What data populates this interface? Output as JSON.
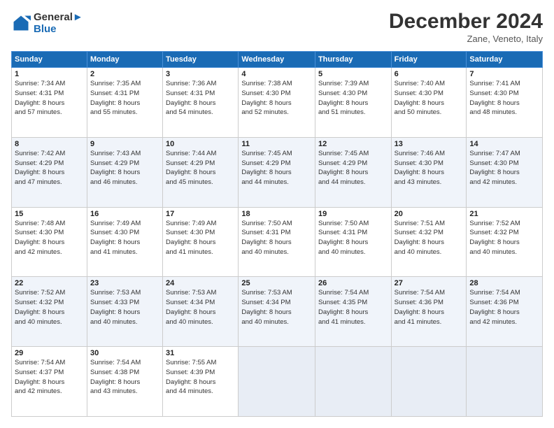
{
  "header": {
    "logo_line1": "General",
    "logo_line2": "Blue",
    "month_title": "December 2024",
    "location": "Zane, Veneto, Italy"
  },
  "days_of_week": [
    "Sunday",
    "Monday",
    "Tuesday",
    "Wednesday",
    "Thursday",
    "Friday",
    "Saturday"
  ],
  "weeks": [
    [
      {
        "day": "1",
        "lines": [
          "Sunrise: 7:34 AM",
          "Sunset: 4:31 PM",
          "Daylight: 8 hours",
          "and 57 minutes."
        ]
      },
      {
        "day": "2",
        "lines": [
          "Sunrise: 7:35 AM",
          "Sunset: 4:31 PM",
          "Daylight: 8 hours",
          "and 55 minutes."
        ]
      },
      {
        "day": "3",
        "lines": [
          "Sunrise: 7:36 AM",
          "Sunset: 4:31 PM",
          "Daylight: 8 hours",
          "and 54 minutes."
        ]
      },
      {
        "day": "4",
        "lines": [
          "Sunrise: 7:38 AM",
          "Sunset: 4:30 PM",
          "Daylight: 8 hours",
          "and 52 minutes."
        ]
      },
      {
        "day": "5",
        "lines": [
          "Sunrise: 7:39 AM",
          "Sunset: 4:30 PM",
          "Daylight: 8 hours",
          "and 51 minutes."
        ]
      },
      {
        "day": "6",
        "lines": [
          "Sunrise: 7:40 AM",
          "Sunset: 4:30 PM",
          "Daylight: 8 hours",
          "and 50 minutes."
        ]
      },
      {
        "day": "7",
        "lines": [
          "Sunrise: 7:41 AM",
          "Sunset: 4:30 PM",
          "Daylight: 8 hours",
          "and 48 minutes."
        ]
      }
    ],
    [
      {
        "day": "8",
        "lines": [
          "Sunrise: 7:42 AM",
          "Sunset: 4:29 PM",
          "Daylight: 8 hours",
          "and 47 minutes."
        ]
      },
      {
        "day": "9",
        "lines": [
          "Sunrise: 7:43 AM",
          "Sunset: 4:29 PM",
          "Daylight: 8 hours",
          "and 46 minutes."
        ]
      },
      {
        "day": "10",
        "lines": [
          "Sunrise: 7:44 AM",
          "Sunset: 4:29 PM",
          "Daylight: 8 hours",
          "and 45 minutes."
        ]
      },
      {
        "day": "11",
        "lines": [
          "Sunrise: 7:45 AM",
          "Sunset: 4:29 PM",
          "Daylight: 8 hours",
          "and 44 minutes."
        ]
      },
      {
        "day": "12",
        "lines": [
          "Sunrise: 7:45 AM",
          "Sunset: 4:29 PM",
          "Daylight: 8 hours",
          "and 44 minutes."
        ]
      },
      {
        "day": "13",
        "lines": [
          "Sunrise: 7:46 AM",
          "Sunset: 4:30 PM",
          "Daylight: 8 hours",
          "and 43 minutes."
        ]
      },
      {
        "day": "14",
        "lines": [
          "Sunrise: 7:47 AM",
          "Sunset: 4:30 PM",
          "Daylight: 8 hours",
          "and 42 minutes."
        ]
      }
    ],
    [
      {
        "day": "15",
        "lines": [
          "Sunrise: 7:48 AM",
          "Sunset: 4:30 PM",
          "Daylight: 8 hours",
          "and 42 minutes."
        ]
      },
      {
        "day": "16",
        "lines": [
          "Sunrise: 7:49 AM",
          "Sunset: 4:30 PM",
          "Daylight: 8 hours",
          "and 41 minutes."
        ]
      },
      {
        "day": "17",
        "lines": [
          "Sunrise: 7:49 AM",
          "Sunset: 4:30 PM",
          "Daylight: 8 hours",
          "and 41 minutes."
        ]
      },
      {
        "day": "18",
        "lines": [
          "Sunrise: 7:50 AM",
          "Sunset: 4:31 PM",
          "Daylight: 8 hours",
          "and 40 minutes."
        ]
      },
      {
        "day": "19",
        "lines": [
          "Sunrise: 7:50 AM",
          "Sunset: 4:31 PM",
          "Daylight: 8 hours",
          "and 40 minutes."
        ]
      },
      {
        "day": "20",
        "lines": [
          "Sunrise: 7:51 AM",
          "Sunset: 4:32 PM",
          "Daylight: 8 hours",
          "and 40 minutes."
        ]
      },
      {
        "day": "21",
        "lines": [
          "Sunrise: 7:52 AM",
          "Sunset: 4:32 PM",
          "Daylight: 8 hours",
          "and 40 minutes."
        ]
      }
    ],
    [
      {
        "day": "22",
        "lines": [
          "Sunrise: 7:52 AM",
          "Sunset: 4:32 PM",
          "Daylight: 8 hours",
          "and 40 minutes."
        ]
      },
      {
        "day": "23",
        "lines": [
          "Sunrise: 7:53 AM",
          "Sunset: 4:33 PM",
          "Daylight: 8 hours",
          "and 40 minutes."
        ]
      },
      {
        "day": "24",
        "lines": [
          "Sunrise: 7:53 AM",
          "Sunset: 4:34 PM",
          "Daylight: 8 hours",
          "and 40 minutes."
        ]
      },
      {
        "day": "25",
        "lines": [
          "Sunrise: 7:53 AM",
          "Sunset: 4:34 PM",
          "Daylight: 8 hours",
          "and 40 minutes."
        ]
      },
      {
        "day": "26",
        "lines": [
          "Sunrise: 7:54 AM",
          "Sunset: 4:35 PM",
          "Daylight: 8 hours",
          "and 41 minutes."
        ]
      },
      {
        "day": "27",
        "lines": [
          "Sunrise: 7:54 AM",
          "Sunset: 4:36 PM",
          "Daylight: 8 hours",
          "and 41 minutes."
        ]
      },
      {
        "day": "28",
        "lines": [
          "Sunrise: 7:54 AM",
          "Sunset: 4:36 PM",
          "Daylight: 8 hours",
          "and 42 minutes."
        ]
      }
    ],
    [
      {
        "day": "29",
        "lines": [
          "Sunrise: 7:54 AM",
          "Sunset: 4:37 PM",
          "Daylight: 8 hours",
          "and 42 minutes."
        ]
      },
      {
        "day": "30",
        "lines": [
          "Sunrise: 7:54 AM",
          "Sunset: 4:38 PM",
          "Daylight: 8 hours",
          "and 43 minutes."
        ]
      },
      {
        "day": "31",
        "lines": [
          "Sunrise: 7:55 AM",
          "Sunset: 4:39 PM",
          "Daylight: 8 hours",
          "and 44 minutes."
        ]
      },
      null,
      null,
      null,
      null
    ]
  ]
}
